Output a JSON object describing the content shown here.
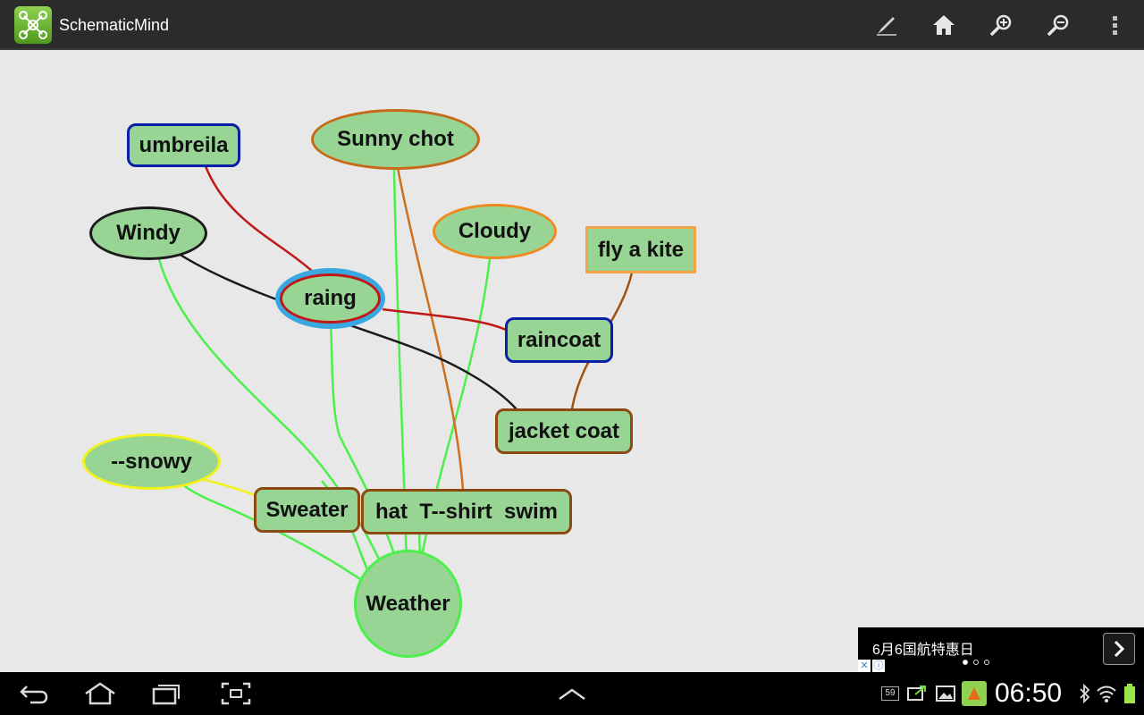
{
  "app": {
    "title": "SchematicMind",
    "icon": "schematicmind-logo-icon"
  },
  "actionbar": {
    "actions": [
      {
        "name": "edit-pen-icon"
      },
      {
        "name": "home-icon"
      },
      {
        "name": "zoom-in-icon"
      },
      {
        "name": "zoom-out-icon"
      },
      {
        "name": "overflow-menu-icon"
      }
    ]
  },
  "mindmap": {
    "nodes": {
      "umbreila": {
        "label": "umbreila",
        "shape": "rounded",
        "border": "#0a1fa8",
        "fill": "#98d595"
      },
      "sunny_chot": {
        "label": "Sunny chot",
        "shape": "ellipse",
        "border": "#c8691a",
        "fill": "#98d595"
      },
      "windy": {
        "label": "Windy",
        "shape": "ellipse",
        "border": "#1a1a1a",
        "fill": "#98d595"
      },
      "cloudy": {
        "label": "Cloudy",
        "shape": "ellipse",
        "border": "#f08a1e",
        "fill": "#98d595"
      },
      "fly_a_kite": {
        "label": "fly a kite",
        "shape": "rect",
        "border": "#f5a34a",
        "fill": "#98d595"
      },
      "raing": {
        "label": "raing",
        "shape": "ellipse",
        "border": "#c01818",
        "outer_border": "#3aa8e0",
        "fill": "#98d595"
      },
      "raincoat": {
        "label": "raincoat",
        "shape": "rounded",
        "border": "#0a1fa8",
        "fill": "#98d595"
      },
      "jacket_coat": {
        "label": "jacket coat",
        "shape": "rounded",
        "border": "#8a4a12",
        "fill": "#98d595"
      },
      "snowy": {
        "label": "--snowy",
        "shape": "ellipse",
        "border": "#f2f21a",
        "fill": "#98d595"
      },
      "sweater": {
        "label": "Sweater",
        "shape": "rounded",
        "border": "#8a4a12",
        "fill": "#98d595"
      },
      "hat_tshirt_swim": {
        "label": "hat  T--shirt  swim",
        "shape": "rounded",
        "border": "#8a4a12",
        "fill": "#98d595"
      },
      "weather": {
        "label": "Weather",
        "shape": "ellipse",
        "border": "#4cf04a",
        "fill": "#98d595"
      }
    },
    "edge_colors": {
      "green": "#4cf04a",
      "red": "#c01818",
      "black": "#1a1a1a",
      "orange": "#d0701e",
      "brown": "#a0520f",
      "yellow": "#f2f21a"
    }
  },
  "ad": {
    "text": "6月6国航特惠日",
    "arrow_icon": "chevron-right-icon",
    "close": "✕",
    "info": "ⓘ"
  },
  "sysbar": {
    "buttons": [
      {
        "name": "back-icon"
      },
      {
        "name": "home-nav-icon"
      },
      {
        "name": "recent-apps-icon"
      },
      {
        "name": "screenshot-icon"
      },
      {
        "name": "chevron-up-icon"
      }
    ],
    "notification_count": "59",
    "clock": "06:50",
    "status_icons": [
      "sync-icon",
      "image-icon",
      "app-notification-icon",
      "bluetooth-icon",
      "wifi-icon",
      "battery-icon"
    ]
  }
}
